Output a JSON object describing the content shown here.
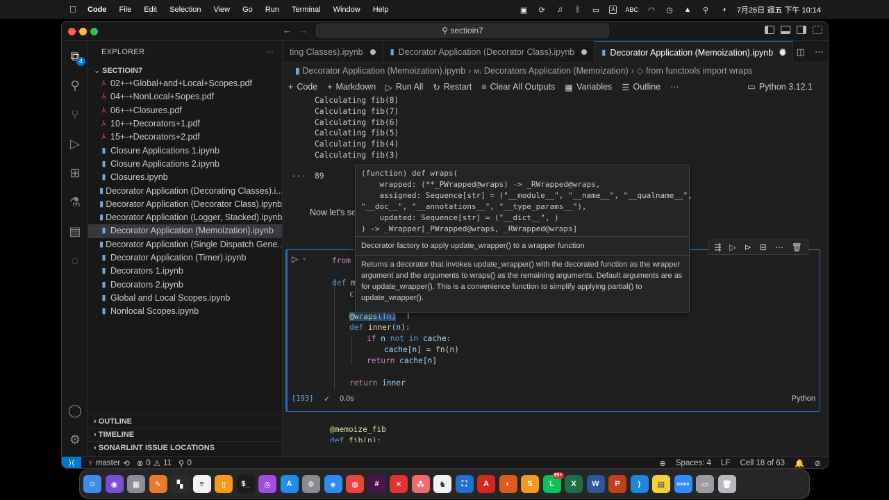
{
  "menubar": {
    "apple_icon": "apple-icon",
    "app": "Code",
    "items": [
      "File",
      "Edit",
      "Selection",
      "View",
      "Go",
      "Run",
      "Terminal",
      "Window",
      "Help"
    ],
    "input_source": "ABC",
    "datetime": "7月26日 週五 下午 10:14"
  },
  "window": {
    "command_center": "sectioin7"
  },
  "activity": {
    "source_control_badge": "4"
  },
  "explorer": {
    "title": "EXPLORER",
    "more": "···",
    "folder": "SECTIOIN7",
    "files": [
      {
        "name": "02+-+Global+and+Local+Scopes.pdf",
        "type": "pdf"
      },
      {
        "name": "04+-+NonLocal+Sopes.pdf",
        "type": "pdf"
      },
      {
        "name": "06+-+Closures.pdf",
        "type": "pdf"
      },
      {
        "name": "10+-+Decorators+1.pdf",
        "type": "pdf"
      },
      {
        "name": "15+-+Decorators+2.pdf",
        "type": "pdf"
      },
      {
        "name": "Closure Applications 1.ipynb",
        "type": "nb"
      },
      {
        "name": "Closure Applications 2.ipynb",
        "type": "nb"
      },
      {
        "name": "Closures.ipynb",
        "type": "nb"
      },
      {
        "name": "Decorator Application (Decorating Classes).i...",
        "type": "nb"
      },
      {
        "name": "Decorator Application (Decorator Class).ipynb",
        "type": "nb"
      },
      {
        "name": "Decorator Application (Logger, Stacked).ipynb",
        "type": "nb"
      },
      {
        "name": "Decorator Application (Memoization).ipynb",
        "type": "nb",
        "active": true
      },
      {
        "name": "Decorator Application (Single Dispatch Gene...",
        "type": "nb"
      },
      {
        "name": "Decorator Application (Timer).ipynb",
        "type": "nb"
      },
      {
        "name": "Decorators 1.ipynb",
        "type": "nb"
      },
      {
        "name": "Decorators 2.ipynb",
        "type": "nb"
      },
      {
        "name": "Global and Local Scopes.ipynb",
        "type": "nb"
      },
      {
        "name": "Nonlocal Scopes.ipynb",
        "type": "nb"
      }
    ],
    "sections": [
      "OUTLINE",
      "TIMELINE",
      "SONARLINT ISSUE LOCATIONS"
    ]
  },
  "tabs": [
    {
      "label": "ting Classes).ipynb",
      "dirty": true
    },
    {
      "label": "Decorator Application (Decorator Class).ipynb",
      "dirty": true
    },
    {
      "label": "Decorator Application (Memoization).ipynb",
      "dirty": true,
      "active": true
    }
  ],
  "breadcrumb": {
    "file": "Decorator Application (Memoization).ipynb",
    "section": "Decorators Application (Memoization)",
    "cell": "from functools import wraps"
  },
  "toolbar": {
    "code": "Code",
    "markdown": "Markdown",
    "run_all": "Run All",
    "restart": "Restart",
    "clear": "Clear All Outputs",
    "variables": "Variables",
    "outline": "Outline",
    "more": "···",
    "kernel": "Python 3.12.1"
  },
  "output": {
    "lines": [
      "Calculating fib(8)",
      "Calculating fib(7)",
      "Calculating fib(6)",
      "Calculating fib(5)",
      "Calculating fib(4)",
      "Calculating fib(3)"
    ],
    "result": "89",
    "markdown_text": "Now let's see"
  },
  "hover": {
    "sig": [
      "(function) def wraps(",
      "    wrapped: (**_PWrapped@wraps) -> _RWrapped@wraps,",
      "    assigned: Sequence[str] = (\"__module__\", \"__name__\", \"__qualname__\",",
      "\"__doc__\", \"__annotations__\", \"__type_params__\"),",
      "    updated: Sequence[str] = (\"__dict__\", )",
      ") -> _Wrapper[_PWrapped@wraps, _RWrapped@wraps]"
    ],
    "summary": "Decorator factory to apply update_wrapper() to a wrapper function",
    "doc": "Returns a decorator that invokes update_wrapper() with the decorated function as the wrapper argument and the arguments to wraps() as the remaining arguments. Default arguments are as for update_wrapper(). This is a convenience function to simplify applying partial() to update_wrapper()."
  },
  "cell": {
    "exec_count": "[193]",
    "duration": "0.0s",
    "language": "Python"
  },
  "status": {
    "branch": "master",
    "errors": "0",
    "warnings": "11",
    "ports": "0",
    "spaces": "Spaces: 4",
    "eol": "LF",
    "cell": "Cell 18 of 63"
  },
  "dock": [
    {
      "name": "finder",
      "color": "#3d8fe6",
      "glyph": "☺"
    },
    {
      "name": "siri",
      "color": "#7a4fd6",
      "glyph": "◉"
    },
    {
      "name": "launchpad",
      "color": "#8d8d96",
      "glyph": "▦"
    },
    {
      "name": "pencil",
      "color": "#e87a2a",
      "glyph": "✎"
    },
    {
      "name": "mosaic",
      "color": "#2b2b2b",
      "glyph": "▚"
    },
    {
      "name": "list",
      "color": "#f2f2f2",
      "glyph": "≡"
    },
    {
      "name": "books",
      "color": "#f29a1f",
      "glyph": "▯"
    },
    {
      "name": "terminal",
      "color": "#1c1c1c",
      "glyph": "$_"
    },
    {
      "name": "podcasts",
      "color": "#9d4fe0",
      "glyph": "◎"
    },
    {
      "name": "app-store",
      "color": "#1f8cf0",
      "glyph": "A"
    },
    {
      "name": "settings",
      "color": "#8a8a90",
      "glyph": "⚙"
    },
    {
      "name": "safari",
      "color": "#2d8cf0",
      "glyph": "◈"
    },
    {
      "name": "chrome",
      "color": "#e8453c",
      "glyph": "◍"
    },
    {
      "name": "slack",
      "color": "#4a154b",
      "glyph": "#"
    },
    {
      "name": "xmind",
      "color": "#e0332d",
      "glyph": "✕"
    },
    {
      "name": "asana",
      "color": "#f06a6a",
      "glyph": "⁂"
    },
    {
      "name": "evernote",
      "color": "#f2f2f2",
      "glyph": "♞"
    },
    {
      "name": "vpn",
      "color": "#1f6fd0",
      "glyph": "⛶"
    },
    {
      "name": "acrobat",
      "color": "#d7261e",
      "glyph": "A"
    },
    {
      "name": "omnifocus",
      "color": "#e05a1c",
      "glyph": "◐"
    },
    {
      "name": "sublime",
      "color": "#f29a1f",
      "glyph": "S"
    },
    {
      "name": "line",
      "color": "#06c755",
      "glyph": "L",
      "badge": "99+"
    },
    {
      "name": "excel",
      "color": "#1d7044",
      "glyph": "X"
    },
    {
      "name": "word",
      "color": "#2b579a",
      "glyph": "W"
    },
    {
      "name": "powerpoint",
      "color": "#c43e1c",
      "glyph": "P"
    },
    {
      "name": "vscode",
      "color": "#1f86d8",
      "glyph": "⟩"
    },
    {
      "name": "notes",
      "color": "#f5d142",
      "glyph": "▤"
    },
    {
      "name": "zoom",
      "color": "#2d8cff",
      "glyph": "zoom"
    },
    {
      "name": "documents",
      "color": "#9a9aa0",
      "glyph": "▭"
    },
    {
      "name": "trash",
      "color": "#b8b8bd",
      "glyph": "🗑"
    }
  ]
}
